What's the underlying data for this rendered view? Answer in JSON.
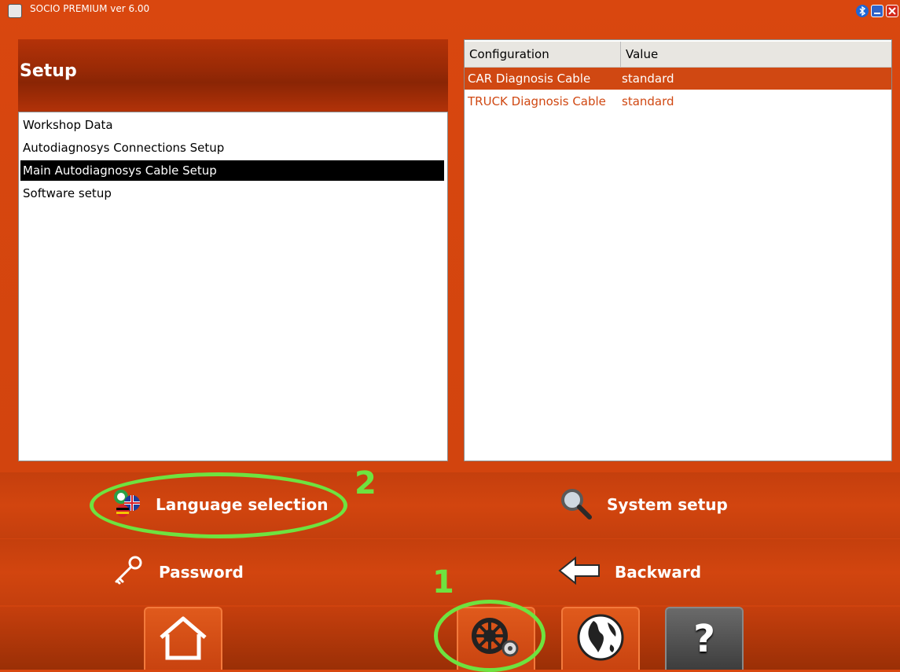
{
  "window": {
    "title": "SOCIO PREMIUM ver 6.00",
    "controls": [
      "bluetooth-icon",
      "minimize-icon",
      "close-icon"
    ]
  },
  "setup_panel": {
    "title": "Setup",
    "items": [
      {
        "label": "Workshop Data",
        "selected": false
      },
      {
        "label": "Autodiagnosys Connections Setup",
        "selected": false
      },
      {
        "label": "Main Autodiagnosys Cable Setup",
        "selected": true
      },
      {
        "label": "Software setup",
        "selected": false
      }
    ]
  },
  "config_table": {
    "headers": [
      "Configuration",
      "Value"
    ],
    "rows": [
      {
        "configuration": "CAR Diagnosis Cable",
        "value": "standard",
        "selected": true
      },
      {
        "configuration": "TRUCK Diagnosis Cable",
        "value": "standard",
        "selected": false
      }
    ]
  },
  "actions": {
    "language_selection": "Language selection",
    "system_setup": "System setup",
    "password": "Password",
    "backward": "Backward"
  },
  "toolbar": {
    "buttons": [
      "home-icon",
      "gears-icon",
      "globe-icon",
      "question-icon"
    ],
    "help_glyph": "?"
  },
  "annotations": {
    "step_1": "1",
    "step_2": "2",
    "color": "#6ee33f"
  },
  "colors": {
    "background": "#d4440f",
    "selected_row": "#d04812",
    "highlight_text": "#d04812"
  }
}
